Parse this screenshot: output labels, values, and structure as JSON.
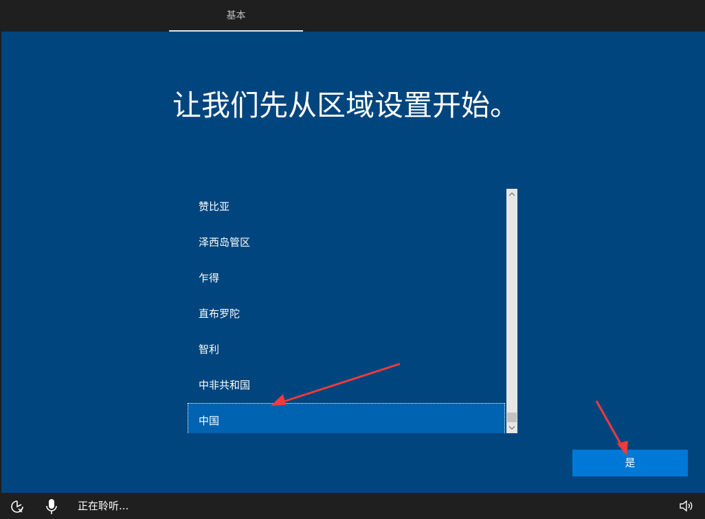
{
  "header": {
    "tab_label": "基本"
  },
  "main": {
    "title": "让我们先从区域设置开始。",
    "regions": [
      "赞比亚",
      "泽西岛管区",
      "乍得",
      "直布罗陀",
      "智利",
      "中非共和国",
      "中国"
    ],
    "selected_region": "中国",
    "yes_label": "是"
  },
  "footer": {
    "listening_label": "正在聆听..."
  },
  "colors": {
    "background": "#00457e",
    "selected": "#0063b1",
    "button": "#0078d7",
    "annotation": "#ef3b3b"
  },
  "icons": {
    "ease_of_access": "ease-of-access-icon",
    "microphone": "microphone-icon",
    "volume": "volume-icon",
    "scroll_up": "chevron-up-icon",
    "scroll_down": "chevron-down-icon"
  }
}
